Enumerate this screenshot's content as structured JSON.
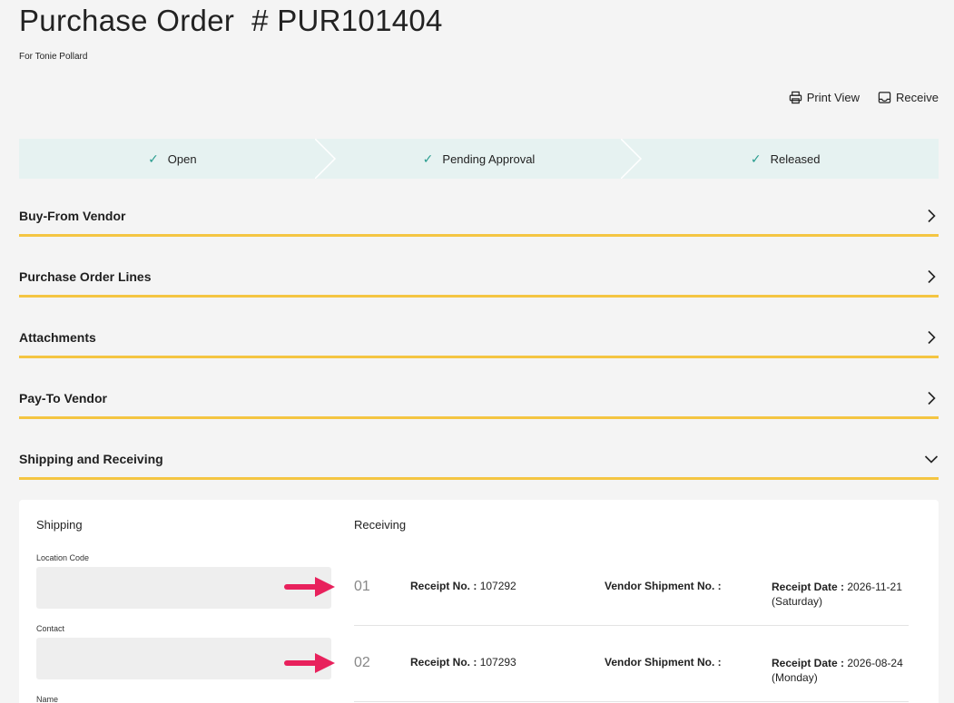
{
  "header": {
    "title": "Purchase Order  # PUR101404",
    "subtitle": "For Tonie Pollard"
  },
  "actions": [
    {
      "label": "Print View",
      "icon": "printer-icon"
    },
    {
      "label": "Receive",
      "icon": "inbox-icon"
    }
  ],
  "steps": [
    {
      "label": "Open",
      "status": "complete"
    },
    {
      "label": "Pending Approval",
      "status": "complete"
    },
    {
      "label": "Released",
      "status": "complete"
    }
  ],
  "sections": [
    {
      "title": "Buy-From Vendor",
      "expanded": false
    },
    {
      "title": "Purchase Order Lines",
      "expanded": false
    },
    {
      "title": "Attachments",
      "expanded": false
    },
    {
      "title": "Pay-To Vendor",
      "expanded": false
    },
    {
      "title": "Shipping and Receiving",
      "expanded": true
    }
  ],
  "shipping": {
    "heading": "Shipping",
    "fields": [
      {
        "label": "Location Code",
        "value": ""
      },
      {
        "label": "Contact",
        "value": ""
      },
      {
        "label": "Name",
        "value": ""
      }
    ]
  },
  "receiving": {
    "heading": "Receiving",
    "receipts": [
      {
        "number": "01",
        "receipt_label": "Receipt No. :",
        "receipt_no": "107292",
        "vendor_label": "Vendor Shipment No. :",
        "vendor_no": "",
        "date_label": "Receipt Date :",
        "date": "2026-11-21",
        "day": "(Saturday)"
      },
      {
        "number": "02",
        "receipt_label": "Receipt No. :",
        "receipt_no": "107293",
        "vendor_label": "Vendor Shipment No. :",
        "vendor_no": "",
        "date_label": "Receipt Date :",
        "date": "2026-08-24",
        "day": "(Monday)"
      }
    ]
  },
  "colors": {
    "accent_underline": "#f4c542",
    "step_bg": "#e6f2f1",
    "check": "#2a9d8f",
    "annotation_arrow": "#e8215c"
  }
}
